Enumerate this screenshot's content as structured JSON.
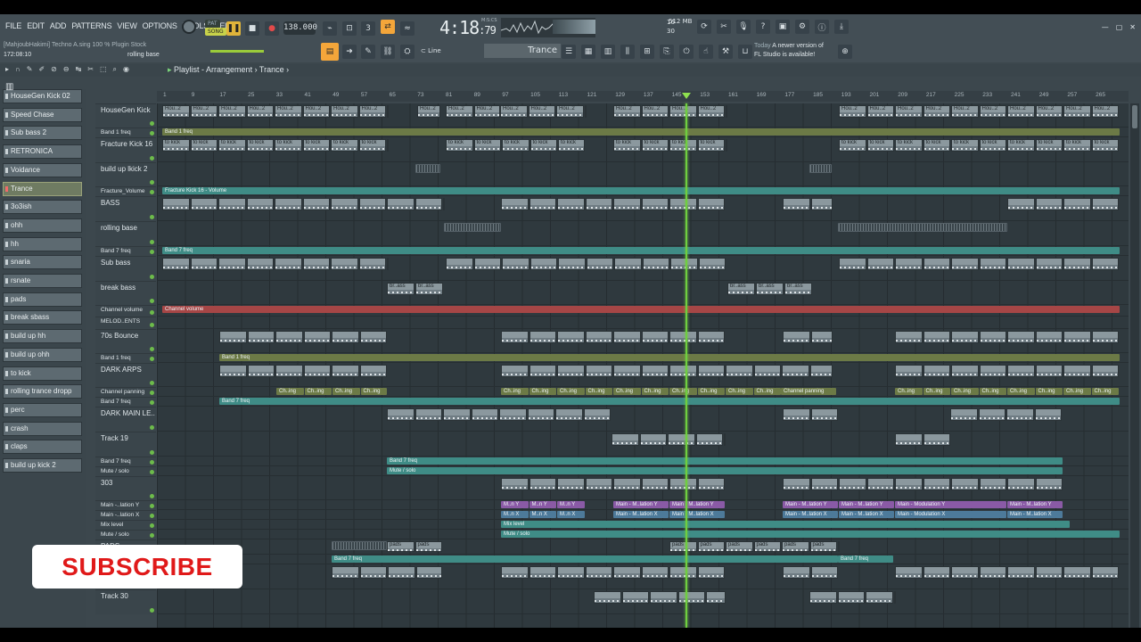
{
  "menu": [
    "FILE",
    "EDIT",
    "ADD",
    "PATTERNS",
    "VIEW",
    "OPTIONS",
    "TOOLS",
    "HELP"
  ],
  "project": {
    "user_line": "[MahjoubHakimi] Techno A.sing 100 % Plugin Stock",
    "position": "172:08:10",
    "hint": "rolling base"
  },
  "transport": {
    "mode": "SONG",
    "tempo": "138.000",
    "time_main": "4:18",
    "time_sub": ":79",
    "time_unit": "M:S:CS",
    "cpu": "16",
    "ram": "512 MB",
    "poly": "30"
  },
  "snap": {
    "label": "Line"
  },
  "preset": "Trance",
  "notice": {
    "label": "Today",
    "text1": "A newer version of",
    "text2": "FL Studio is available!"
  },
  "playlist": {
    "title": "Playlist - Arrangement",
    "pattern": "Trance"
  },
  "picker": [
    "HouseGen Kick 02",
    "Speed Chase",
    "Sub bass 2",
    "RETRONICA",
    "Voidance",
    "Trance",
    "3o3ish",
    "ohh",
    "hh",
    "snaria",
    "rsnate",
    "pads",
    "break sbass",
    "build up hh",
    "build up ohh",
    "to kick",
    "rolling trance dropp",
    "perc",
    "crash",
    "claps",
    "build up kick 2"
  ],
  "picker_selected": 5,
  "ruler": [
    "1",
    "9",
    "17",
    "25",
    "33",
    "41",
    "49",
    "57",
    "65",
    "73",
    "81",
    "89",
    "97",
    "105",
    "113",
    "121",
    "129",
    "137",
    "145",
    "153",
    "161",
    "169",
    "177",
    "185",
    "193",
    "201",
    "209",
    "217",
    "225",
    "233",
    "241",
    "249",
    "257",
    "265"
  ],
  "tracks": [
    {
      "name": "HouseGen Kick",
      "h": 27
    },
    {
      "name": "Band 1 freq",
      "h": 11,
      "auto": true
    },
    {
      "name": "Fracture Kick 16",
      "h": 28
    },
    {
      "name": "build up lkick 2",
      "h": 27
    },
    {
      "name": "Fracture_Volume",
      "h": 11,
      "auto": true
    },
    {
      "name": "BASS",
      "h": 28
    },
    {
      "name": "rolling base",
      "h": 28
    },
    {
      "name": "Band 7 freq",
      "h": 11,
      "auto": true
    },
    {
      "name": "Sub bass",
      "h": 28
    },
    {
      "name": "break bass",
      "h": 27
    },
    {
      "name": "Channel volume",
      "h": 13,
      "auto": true
    },
    {
      "name": "MELOD..ENTS",
      "h": 14,
      "auto": true
    },
    {
      "name": "70s Bounce",
      "h": 27
    },
    {
      "name": "Band 1 freq",
      "h": 11,
      "auto": true
    },
    {
      "name": "DARK ARPS",
      "h": 27
    },
    {
      "name": "Channel panning",
      "h": 11,
      "auto": true
    },
    {
      "name": "Band 7 freq",
      "h": 11,
      "auto": true
    },
    {
      "name": "DARK MAIN LE..",
      "h": 28
    },
    {
      "name": "Track 19",
      "h": 28
    },
    {
      "name": "Band 7 freq",
      "h": 11,
      "auto": true
    },
    {
      "name": "Mute / solo",
      "h": 11,
      "auto": true
    },
    {
      "name": "303",
      "h": 27
    },
    {
      "name": "Main -..lation Y",
      "h": 11,
      "auto": true
    },
    {
      "name": "Main -..lation X",
      "h": 11,
      "auto": true
    },
    {
      "name": "Mix level",
      "h": 11,
      "auto": true
    },
    {
      "name": "Mute / solo",
      "h": 11,
      "auto": true
    },
    {
      "name": "PADS",
      "h": 17
    },
    {
      "name": "",
      "h": 11,
      "auto": true
    },
    {
      "name": "",
      "h": 28
    },
    {
      "name": "Track 30",
      "h": 28
    }
  ],
  "clip_labels": {
    "kick": "Hou..2",
    "band1": "Band 1 freq",
    "tokick": "to kick",
    "fvol": "Fracture Kick 16 - Volume",
    "band7": "Band 7 freq",
    "brass": "br..ass",
    "chvol": "Channel volume",
    "chpan": "Channel panning",
    "chpan_short": "Ch..ing",
    "mute": "Mute / solo",
    "mainy": "Main - M..lation Y",
    "mainx": "Main - M..lation X",
    "mainy_short": "M..n Y",
    "mainx_short": "M..n X",
    "mody": "Main - Modulation Y",
    "modx": "Main - Modulation X",
    "mix": "Mix level",
    "pads": "pads"
  },
  "overlay": {
    "subscribe": "SUBSCRIBE"
  },
  "colors": {
    "accent": "#f4a63a",
    "playhead": "#6fcf3f",
    "auto_olive": "#6c7a46",
    "auto_teal": "#3f8c86",
    "auto_red": "#a64646",
    "auto_purple": "#8a5aa6"
  }
}
